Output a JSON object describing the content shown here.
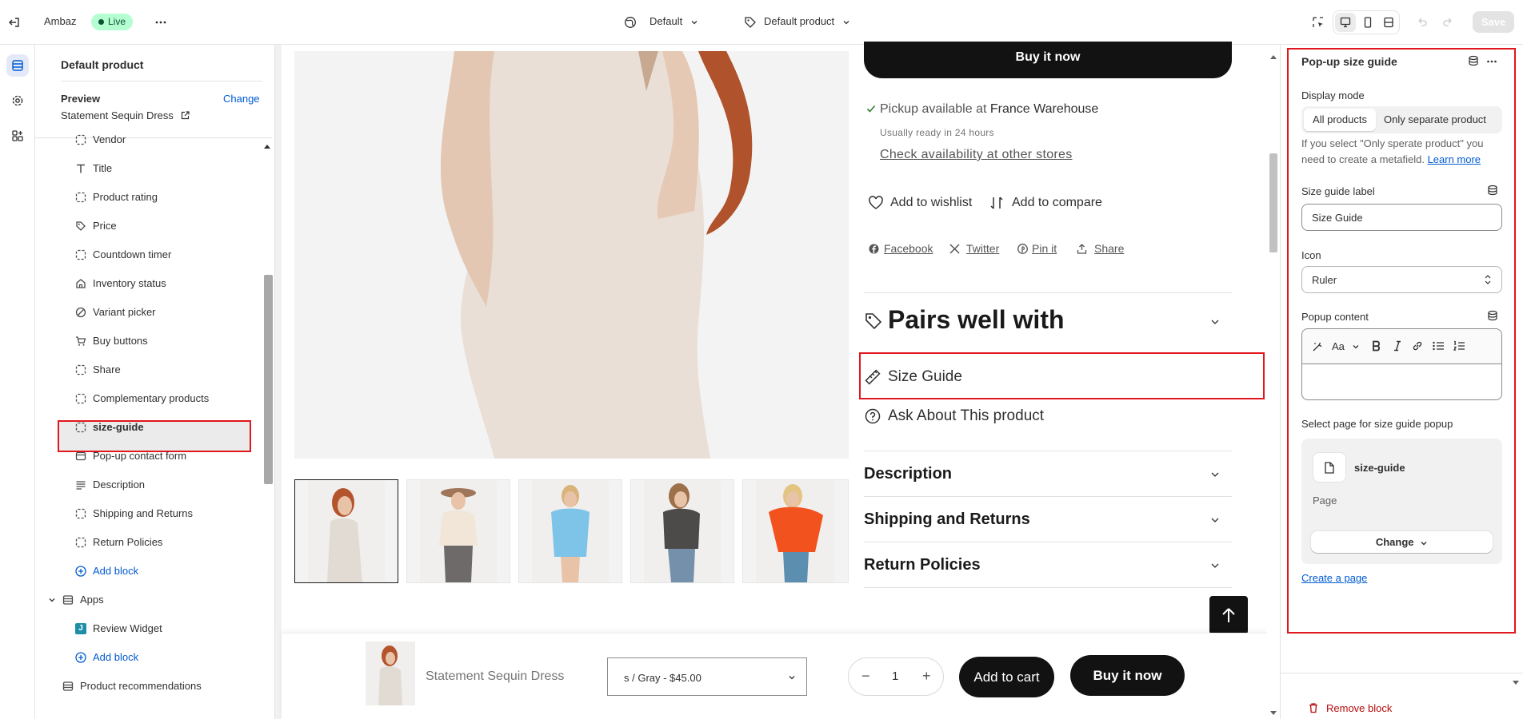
{
  "topbar": {
    "store_name": "Ambaz",
    "status_badge": "Live",
    "theme_select": "Default",
    "template_select": "Default product",
    "save_label": "Save"
  },
  "sidebar": {
    "title": "Default product",
    "preview_label": "Preview",
    "change_label": "Change",
    "preview_product": "Statement Sequin Dress",
    "blocks": [
      {
        "label": "Vendor",
        "icon": "dashed-square-icon"
      },
      {
        "label": "Title",
        "icon": "text-icon"
      },
      {
        "label": "Product rating",
        "icon": "dashed-square-icon"
      },
      {
        "label": "Price",
        "icon": "price-tag-icon"
      },
      {
        "label": "Countdown timer",
        "icon": "dashed-square-icon"
      },
      {
        "label": "Inventory status",
        "icon": "store-icon"
      },
      {
        "label": "Variant picker",
        "icon": "variant-icon"
      },
      {
        "label": "Buy buttons",
        "icon": "cart-icon"
      },
      {
        "label": "Share",
        "icon": "dashed-square-icon"
      },
      {
        "label": "Complementary products",
        "icon": "dashed-square-icon"
      },
      {
        "label": "size-guide",
        "icon": "dashed-square-icon"
      },
      {
        "label": "Pop-up contact form",
        "icon": "popup-icon"
      },
      {
        "label": "Description",
        "icon": "align-left-icon"
      },
      {
        "label": "Shipping and Returns",
        "icon": "dashed-square-icon"
      },
      {
        "label": "Return Policies",
        "icon": "dashed-square-icon"
      }
    ],
    "add_block_label": "Add block",
    "apps_section_label": "Apps",
    "app_widget_label": "Review Widget",
    "app_add_block_label": "Add block",
    "product_recommendations_label": "Product recommendations"
  },
  "preview": {
    "buy_now_top": "Buy it now",
    "pickup_prefix": "Pickup available at ",
    "pickup_location": "France Warehouse",
    "pickup_ready": "Usually ready in 24 hours",
    "check_availability": "Check availability at other stores",
    "wishlist": "Add to wishlist",
    "compare": "Add to compare",
    "share_links": [
      "Facebook",
      "Twitter",
      "Pin it",
      "Share"
    ],
    "pairs_heading": "Pairs well with",
    "size_guide": "Size Guide",
    "ask_about": "Ask About This product",
    "accordions": [
      "Description",
      "Shipping and Returns",
      "Return Policies"
    ],
    "sticky": {
      "product_name": "Statement Sequin Dress",
      "variant": "s / Gray - $45.00",
      "quantity": "1",
      "minus": "−",
      "plus": "+",
      "add_to_cart": "Add to cart",
      "buy_now": "Buy it now"
    }
  },
  "settings": {
    "title": "Pop-up size guide",
    "display_mode_label": "Display mode",
    "display_modes": [
      "All products",
      "Only separate product"
    ],
    "selected_mode": "All products",
    "help_text": "If you select \"Only sperate product\" you need to create a metafield.",
    "learn_more": "Learn more",
    "size_guide_label_title": "Size guide label",
    "size_guide_label_value": "Size Guide",
    "icon_title": "Icon",
    "icon_value": "Ruler",
    "popup_content_title": "Popup content",
    "rte_font_label": "Aa",
    "select_page_title": "Select page for size guide popup",
    "page_name": "size-guide",
    "page_type": "Page",
    "change_button": "Change",
    "create_page": "Create a page",
    "remove_block": "Remove block"
  },
  "colors": {
    "highlight": "#e0171e",
    "link": "#005bd3",
    "live_badge": "#b4fed2",
    "button_dark": "#121212"
  }
}
